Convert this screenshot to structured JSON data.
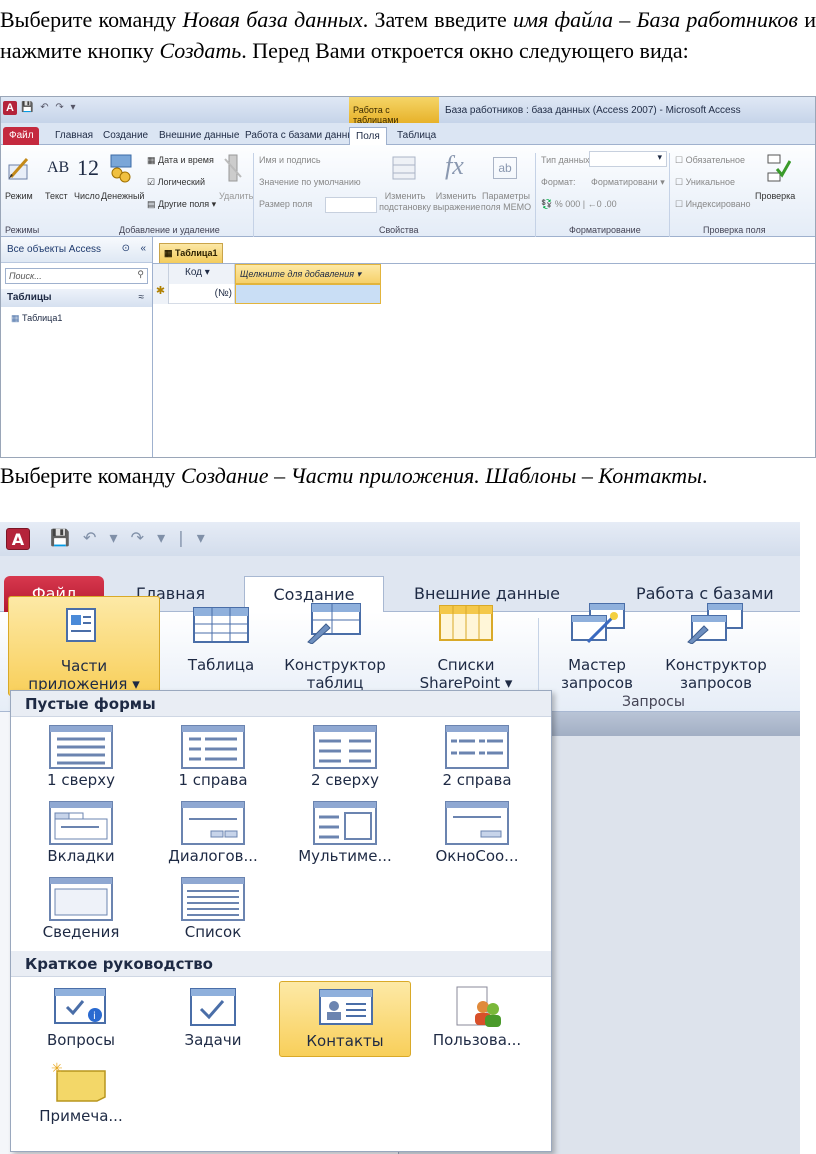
{
  "text": {
    "p1_a": "Выберите команду ",
    "p1_b": "Новая база данных",
    "p1_c": ". Затем введите ",
    "p1_d": "имя файла",
    "p1_e": " – ",
    "p1_f": "База работников",
    "p1_g": " и нажмите кнопку ",
    "p1_h": "Создать",
    "p1_i": ". Перед Вами откроется окно следующего вида:",
    "p2_a": "Выберите команду ",
    "p2_b": "Создание",
    "p2_c": " – ",
    "p2_d": "Части приложения. Шаблоны – Контакты",
    "p2_e": "."
  },
  "screen1": {
    "logo": "A",
    "context_tab": "Работа с таблицами",
    "window_title": "База работников : база данных (Access 2007) - Microsoft Access",
    "tabs": [
      "Файл",
      "Главная",
      "Создание",
      "Внешние данные",
      "Работа с базами данных",
      "Поля",
      "Таблица"
    ],
    "ribbon": {
      "mode": "Режим",
      "text": "Текст",
      "number": "Число",
      "money": "Денежный",
      "datetime": "Дата и время",
      "logical": "Логический",
      "other": "Другие поля",
      "delete": "Удалить",
      "name_caption": "Имя и подпись",
      "default_value": "Значение по умолчанию",
      "field_size": "Размер поля",
      "change_lookup": "Изменить подстановку",
      "change_expr": "Изменить выражение",
      "memo_params": "Параметры поля MEMO",
      "data_type": "Тип данных:",
      "format": "Формат:",
      "formatting": "Форматировани",
      "required": "Обязательное",
      "unique": "Уникальное",
      "indexed": "Индексировано",
      "validation": "Проверка",
      "groups": [
        "Режимы",
        "Добавление и удаление",
        "Свойства",
        "Форматирование",
        "Проверка поля"
      ]
    },
    "nav": {
      "header": "Все объекты Access",
      "search": "Поиск...",
      "group": "Таблицы",
      "item": "Таблица1"
    },
    "doc": {
      "tab": "Таблица1",
      "col_code": "Код",
      "col_add": "Щелкните для добавления",
      "new_row_value": "(№)"
    }
  },
  "screen2": {
    "logo": "A",
    "tabs": [
      "Файл",
      "Главная",
      "Создание",
      "Внешние данные",
      "Работа с базами"
    ],
    "ribbon_buttons": [
      {
        "line1": "Части",
        "line2": "приложения ▾"
      },
      {
        "line1": "Таблица",
        "line2": ""
      },
      {
        "line1": "Конструктор",
        "line2": "таблиц"
      },
      {
        "line1": "Списки",
        "line2": "SharePoint ▾"
      },
      {
        "line1": "Мастер",
        "line2": "запросов"
      },
      {
        "line1": "Конструктор",
        "line2": "запросов"
      }
    ],
    "group_queries": "Запросы",
    "section_blank": "Пустые формы",
    "blank_forms": [
      "1 сверху",
      "1 справа",
      "2 сверху",
      "2 справа",
      "Вкладки",
      "Диалогов...",
      "Мультиме...",
      "ОкноСоо...",
      "Сведения",
      "Список"
    ],
    "section_quick": "Краткое руководство",
    "quick_start": [
      "Вопросы",
      "Задачи",
      "Контакты",
      "Пользова...",
      "Примеча..."
    ]
  }
}
